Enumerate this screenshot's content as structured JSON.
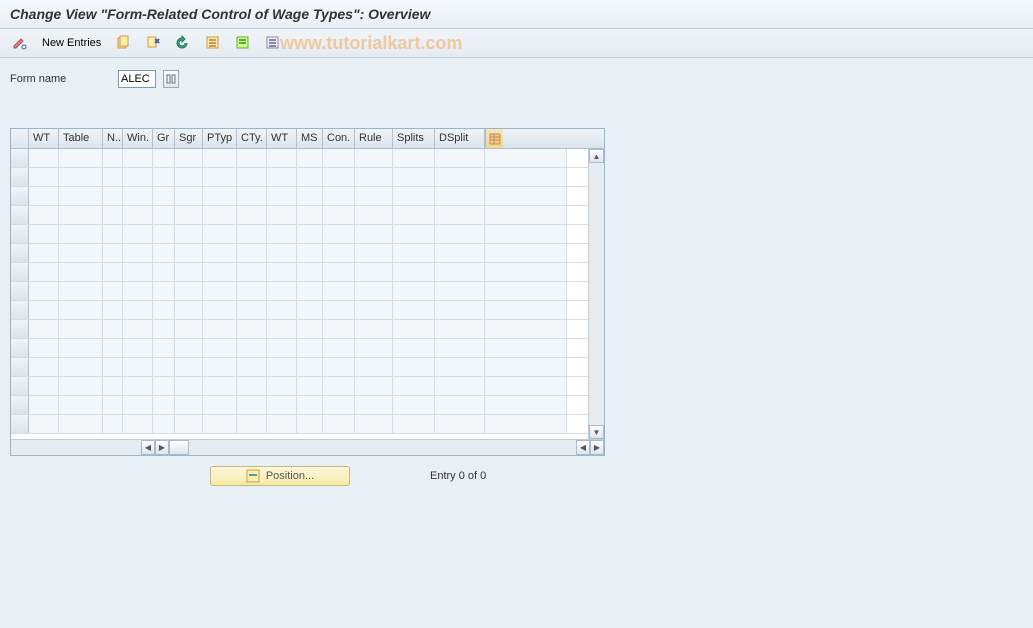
{
  "title": "Change View \"Form-Related Control of Wage Types\": Overview",
  "toolbar": {
    "new_entries_label": "New Entries"
  },
  "watermark": "www.tutorialkart.com",
  "form": {
    "name_label": "Form name",
    "name_value": "ALEC"
  },
  "table": {
    "columns": [
      "",
      "WT",
      "Table",
      "N..",
      "Win.",
      "Gr",
      "Sgr",
      "PTyp",
      "CTy.",
      "WT",
      "MS",
      "Con.",
      "Rule",
      "Splits",
      "DSplit"
    ],
    "empty_rows": 15
  },
  "footer": {
    "position_label": "Position...",
    "entry_text": "Entry 0 of 0"
  }
}
